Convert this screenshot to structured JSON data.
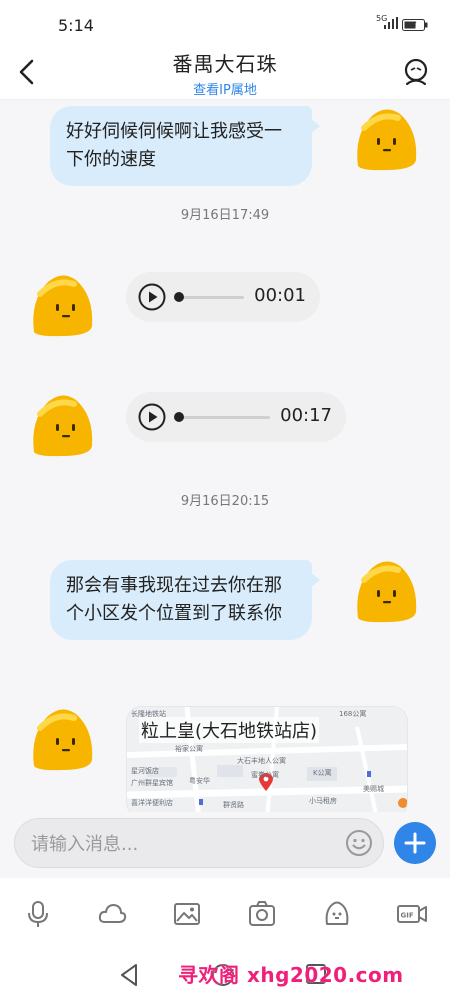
{
  "status_bar": {
    "time": "5:14",
    "network": "5G",
    "icons": [
      "signal-icon",
      "battery-icon"
    ]
  },
  "header": {
    "title": "番禺大石珠",
    "subtitle": "查看IP属地",
    "back_icon": "back-arrow-icon",
    "profile_icon": "profile-icon"
  },
  "messages": {
    "m1": {
      "text": "好好伺候伺候啊让我感受一下你的速度"
    },
    "t1": {
      "text": "9月16日17:49"
    },
    "v1": {
      "duration": "00:01"
    },
    "v2": {
      "duration": "00:17"
    },
    "t2": {
      "text": "9月16日20:15"
    },
    "m2": {
      "text": "那会有事我现在过去你在那个小区发个位置到了联系你"
    },
    "loc": {
      "title": "粒上皇(大石地铁站店)",
      "labels": [
        "长隆地铁站",
        "168公寓",
        "裕家公寓",
        "大石丰地人公寓",
        "广州群星宾馆",
        "粤安华",
        "蜜卷公寓",
        "K公寓",
        "星河饭店",
        "喜洋洋便利店",
        "群贤路",
        "小马租房",
        "美赐城"
      ]
    }
  },
  "input": {
    "placeholder": "请输入消息...",
    "value": ""
  },
  "toolbar": {
    "items": [
      "microphone-icon",
      "cloud-icon",
      "image-icon",
      "camera-icon",
      "sticker-icon",
      "gif-video-icon"
    ]
  },
  "navbar": {
    "watermark": "寻欢阁 xhg2020.com"
  },
  "colors": {
    "accent": "#2f86e8",
    "bubble": "#d9ecfb",
    "watermark": "#f0207a",
    "avatar": "#f7b500"
  }
}
